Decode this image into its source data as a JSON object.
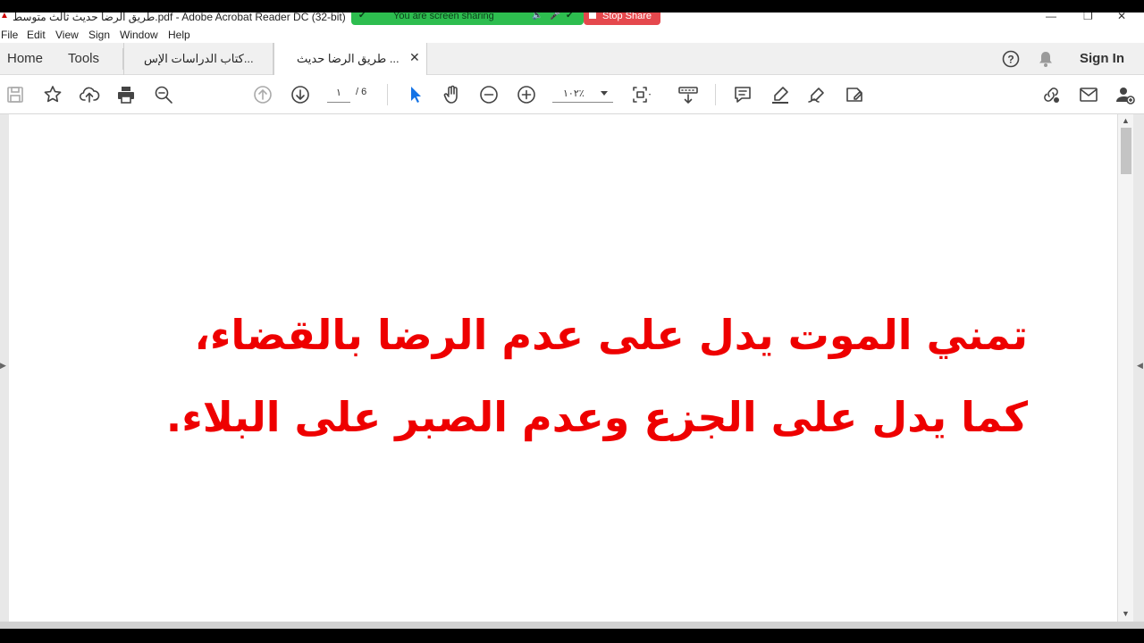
{
  "window": {
    "title": "طريق الرضا حديث ثالث متوسط.pdf - Adobe Acrobat Reader DC (32-bit)",
    "controls": [
      "—",
      "❐",
      "✕"
    ]
  },
  "screen_share": {
    "status_text": "You are screen sharing",
    "stop_label": "Stop Share"
  },
  "menu": [
    "File",
    "Edit",
    "View",
    "Sign",
    "Window",
    "Help"
  ],
  "nav": {
    "home_label": "Home",
    "tools_label": "Tools",
    "tabs": [
      {
        "label": "كتاب الدراسات الإس...",
        "active": false
      },
      {
        "label": "طريق الرضا حديث ...",
        "active": true
      }
    ],
    "sign_in_label": "Sign In"
  },
  "toolbar": {
    "page_current": "١",
    "page_total": "/ 6",
    "zoom": "١٠٢٪"
  },
  "document": {
    "lines": [
      "تمني الموت يدل على عدم الرضا بالقضاء،",
      "كما يدل على الجزع وعدم الصبر على البلاء."
    ],
    "text_color": "#ee0000"
  },
  "colors": {
    "share_green": "#2dbd4f",
    "stop_red": "#e5484d",
    "select_blue": "#1473e6"
  }
}
